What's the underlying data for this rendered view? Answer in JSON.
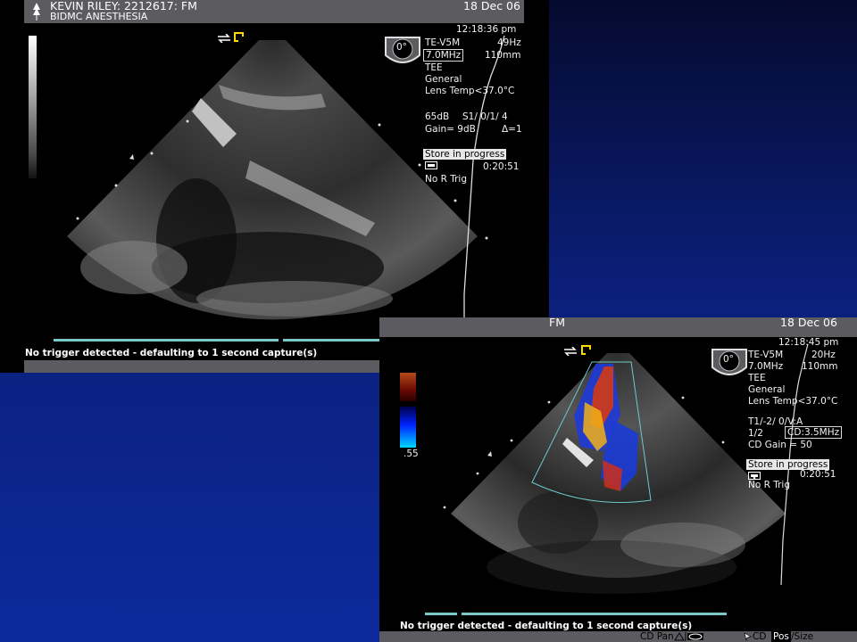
{
  "panel_a": {
    "header": {
      "patient": "KEVIN RILEY: 2212617: FM",
      "department": "BIDMC ANESTHESIA",
      "date": "18 Dec 06"
    },
    "time": "12:18:36 pm",
    "angle": "0°",
    "settings": {
      "probe": "TE-V5M",
      "frame_rate": "49Hz",
      "frequency": "7.0MHz",
      "depth": "110mm",
      "mode": "TEE",
      "preset": "General",
      "lens_temp": "Lens Temp<37.0°C",
      "dynamic_range": "65dB",
      "s_setting": "S1/ 0/1/ 4",
      "gain": "Gain= 9dB",
      "delta": "Δ=1"
    },
    "store_label": "Store in progress",
    "store_time": "0:20:51",
    "trigger": "No R Trig",
    "status_message": "No trigger detected - defaulting to 1 second capture(s)"
  },
  "panel_b": {
    "header": {
      "patient_tail": "FM",
      "date": "18 Dec 06"
    },
    "time": "12:18:45 pm",
    "angle": "0°",
    "scale_value": ".55",
    "settings": {
      "probe": "TE-V5M",
      "frame_rate": "20Hz",
      "frequency": "7.0MHz",
      "depth": "110mm",
      "mode": "TEE",
      "preset": "General",
      "lens_temp": "Lens Temp<37.0°C",
      "t_setting": "T1/-2/ 0/V:A",
      "ratio": "1/2",
      "cd_freq": "CD:3.5MHz",
      "cd_gain": "CD Gain = 50"
    },
    "store_label": "Store in progress",
    "store_time": "0:20:51",
    "trigger": "No R Trig",
    "status_message": "No trigger detected - defaulting to 1 second capture(s)",
    "footer": {
      "cd_pan": "CD Pan",
      "cd_pos": "CD",
      "pos_label": "Pos",
      "size_label": "/Size"
    }
  },
  "colors": {
    "background_top": "#050a2e",
    "background_bottom": "#0c2a9c",
    "bar_gray": "#5b5b60",
    "teal": "#79c7c7",
    "doppler_red": "#d63a18",
    "doppler_blue": "#1740e0"
  },
  "icons": [
    "reverse-arrows-icon",
    "probe-marker-icon",
    "angle-indicator-icon",
    "recording-icon"
  ]
}
